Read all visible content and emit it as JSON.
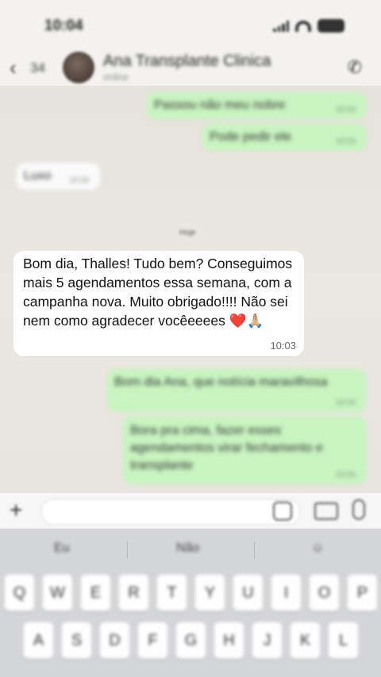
{
  "status_bar": {
    "time": "10:04"
  },
  "header": {
    "back_count": "34",
    "contact_name": "Ana Transplante Clinica",
    "contact_status": "online"
  },
  "messages": [
    {
      "direction": "out",
      "text": "Passou não meu nobre",
      "time": "10:03"
    },
    {
      "direction": "out",
      "text": "Pode pedir ele",
      "time": "10:03"
    },
    {
      "direction": "in",
      "text": "Luxo",
      "time": "10:03"
    },
    {
      "direction": "in",
      "text": "Bom dia, Thalles! Tudo bem? Conseguimos mais 5 agendamentos essa semana, com a campanha nova. Muito obrigado!!!! Não sei nem como agradecer vocêeeees ❤️🙏🏼",
      "time": "10:03"
    },
    {
      "direction": "out",
      "text": "Bom dia Ana, que notícia maravilhosa",
      "time": "10:04"
    },
    {
      "direction": "out",
      "text": "Bora pra cima, fazer esses agendamentos virar fechamento e transplante",
      "time": "10:04"
    }
  ],
  "day_separator": "Hoje",
  "keyboard": {
    "suggestions": [
      "Eu",
      "Não",
      "☺"
    ],
    "row1": [
      "Q",
      "W",
      "E",
      "R",
      "T",
      "Y",
      "U",
      "I",
      "O",
      "P"
    ],
    "row2": [
      "A",
      "S",
      "D",
      "F",
      "G",
      "H",
      "J",
      "K",
      "L"
    ]
  }
}
